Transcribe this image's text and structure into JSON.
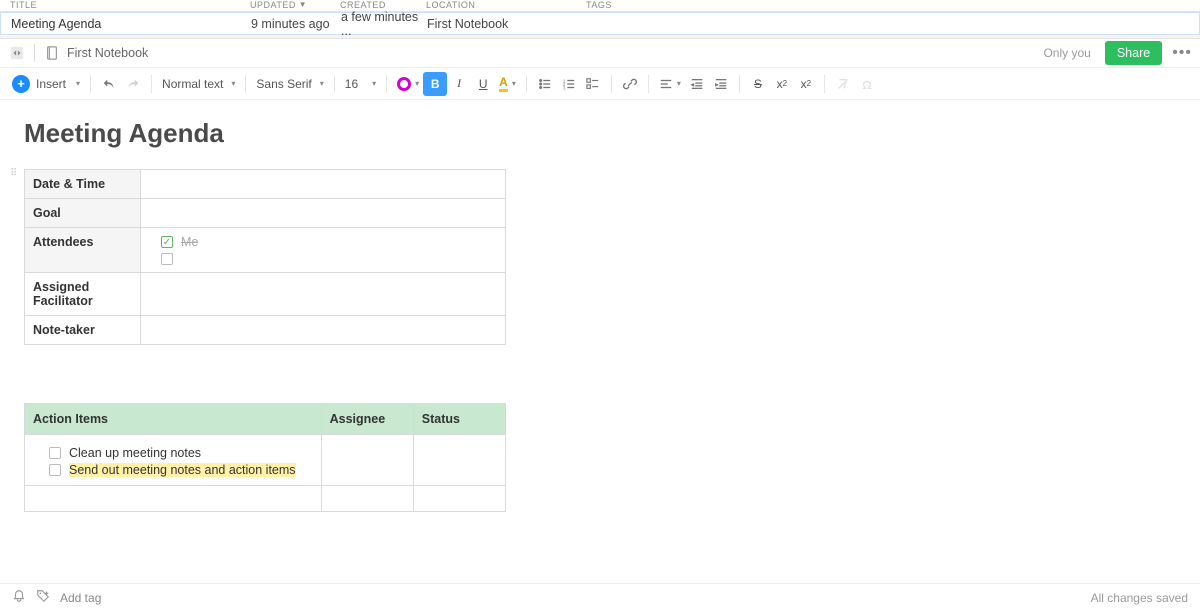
{
  "list": {
    "headers": {
      "title": "TITLE",
      "updated": "UPDATED",
      "created": "CREATED",
      "location": "LOCATION",
      "tags": "TAGS"
    },
    "row": {
      "title": "Meeting Agenda",
      "updated": "9 minutes ago",
      "created": "a few minutes ...",
      "location": "First Notebook",
      "tags": ""
    }
  },
  "noteHeader": {
    "notebook": "First Notebook",
    "visibility": "Only you",
    "share": "Share"
  },
  "toolbar": {
    "insert": "Insert",
    "paragraph": "Normal text",
    "font": "Sans Serif",
    "size": "16"
  },
  "doc": {
    "title": "Meeting Agenda",
    "meta": {
      "dateTime": "Date & Time",
      "goal": "Goal",
      "attendees": "Attendees",
      "attendeeMe": "Me",
      "facilitator": "Assigned Facilitator",
      "noteTaker": "Note-taker"
    },
    "action": {
      "headers": {
        "items": "Action Items",
        "assignee": "Assignee",
        "status": "Status"
      },
      "item1": "Clean up meeting notes",
      "item2": "Send out meeting notes and action items"
    }
  },
  "footer": {
    "addTag": "Add tag",
    "saveStatus": "All changes saved"
  }
}
